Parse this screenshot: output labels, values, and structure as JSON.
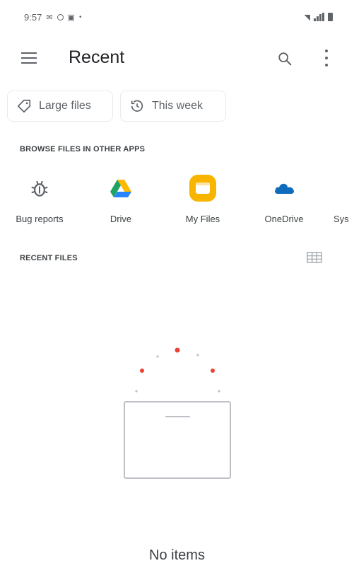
{
  "status_bar": {
    "time": "9:57",
    "icons": [
      "notification-icon",
      "circle-icon",
      "message-icon",
      "dot-icon"
    ],
    "right_icons": [
      "wifi-icon",
      "signal-icon",
      "battery-icon"
    ]
  },
  "app_bar": {
    "title": "Recent",
    "icons": [
      "menu-icon",
      "search-icon",
      "more-vert-icon"
    ]
  },
  "filters": [
    {
      "label": "Large files",
      "icon": "tag-icon"
    },
    {
      "label": "This week",
      "icon": "history-icon"
    }
  ],
  "browse_section": {
    "label": "BROWSE FILES IN OTHER APPS",
    "apps": [
      {
        "label": "Bug reports",
        "icon": "bug-icon"
      },
      {
        "label": "Drive",
        "icon": "google-drive-icon"
      },
      {
        "label": "My Files",
        "icon": "my-files-icon"
      },
      {
        "label": "OneDrive",
        "icon": "onedrive-icon"
      },
      {
        "label": "Sys",
        "icon": "system-icon"
      }
    ]
  },
  "recent_section": {
    "label": "RECENT FILES",
    "view_toggle_icon": "grid-view-icon"
  },
  "empty_state": {
    "message": "No items"
  },
  "colors": {
    "drive_green": "#1ea362",
    "drive_yellow": "#ffba00",
    "drive_blue": "#2684fc",
    "myfiles_yellow": "#f7b500",
    "onedrive_blue": "#0f6cbd",
    "accent_red": "#ea4335"
  }
}
